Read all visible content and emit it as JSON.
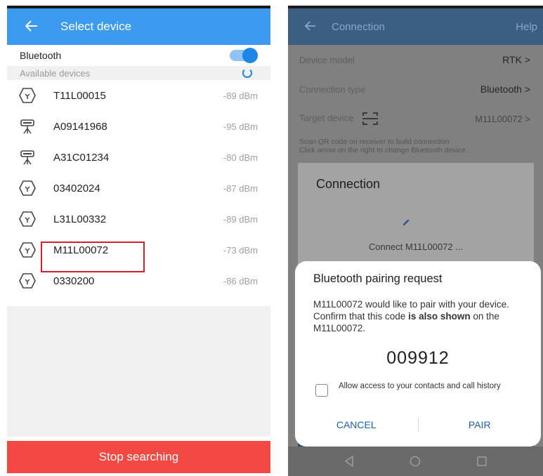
{
  "left": {
    "title": "Select device",
    "bluetooth_label": "Bluetooth",
    "bluetooth_on": true,
    "available_label": "Available devices",
    "devices": [
      {
        "name": "T11L00015",
        "signal": "-89 dBm",
        "icon": "rover-receiver-icon"
      },
      {
        "name": "A09141968",
        "signal": "-95 dBm",
        "icon": "base-station-icon"
      },
      {
        "name": "A31C01234",
        "signal": "-80 dBm",
        "icon": "base-station-icon"
      },
      {
        "name": "03402024",
        "signal": "-87 dBm",
        "icon": "rover-receiver-icon"
      },
      {
        "name": "L31L00332",
        "signal": "-89 dBm",
        "icon": "rover-receiver-icon"
      },
      {
        "name": "M11L00072",
        "signal": "-73 dBm",
        "icon": "rover-receiver-icon"
      },
      {
        "name": "0330200",
        "signal": "-86 dBm",
        "icon": "rover-receiver-icon"
      }
    ],
    "stop_button": "Stop searching",
    "accent_color": "#3d9bef",
    "stop_color": "#f44942"
  },
  "right": {
    "title": "Connection",
    "help": "Help",
    "device_model_label": "Device model",
    "device_model_value": "RTK",
    "connection_type_label": "Connection type",
    "connection_type_value": "Bluetooth",
    "target_device_label": "Target device",
    "target_device_value": "M11L00072",
    "hint_line1": "Scan QR code on receiver to build connection",
    "hint_line2": "Click arrow on the right to change Bluetooth device.",
    "connection_dialog": {
      "title": "Connection",
      "message": "Connect M11L00072 ..."
    },
    "pair_dialog": {
      "title": "Bluetooth pairing request",
      "msg_part1": "M11L00072 would like to pair with your device. Confirm that this code ",
      "msg_bold1": "is also",
      "msg_bold2": "shown",
      "msg_part2": " on the M11L00072.",
      "code": "009912",
      "checkbox_label": "Allow access to your contacts and call history",
      "cancel": "CANCEL",
      "pair": "PAIR"
    }
  }
}
